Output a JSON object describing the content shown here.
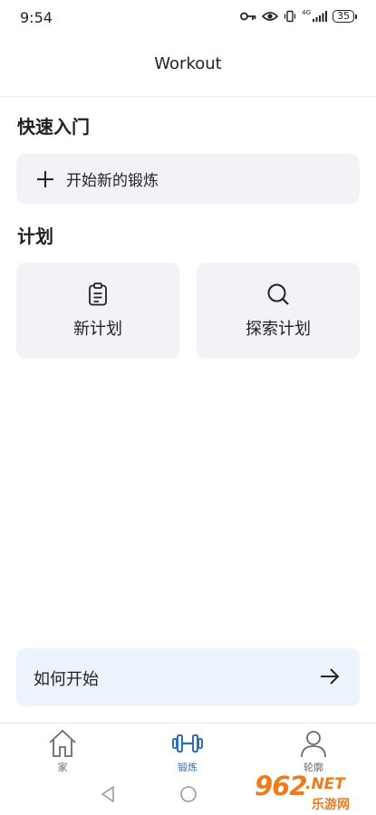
{
  "status_bar": {
    "time": "9:54",
    "network": "4G",
    "battery": "35"
  },
  "header": {
    "title": "Workout"
  },
  "quick_start": {
    "title": "快速入门",
    "start_button_label": "开始新的锻炼",
    "start_icon": "plus-icon"
  },
  "plans": {
    "title": "计划",
    "cards": [
      {
        "label": "新计划",
        "icon": "clipboard-icon"
      },
      {
        "label": "探索计划",
        "icon": "search-icon"
      }
    ]
  },
  "how_to": {
    "label": "如何开始",
    "icon": "arrow-right-icon"
  },
  "bottom_nav": {
    "items": [
      {
        "label": "家",
        "icon": "home-icon",
        "active": false
      },
      {
        "label": "锻炼",
        "icon": "dumbbell-icon",
        "active": true
      },
      {
        "label": "轮廓",
        "icon": "person-icon",
        "active": false
      }
    ]
  },
  "system_nav": {
    "buttons": [
      "back-icon",
      "home-circle-icon"
    ]
  },
  "watermark": {
    "brand": "962",
    "domain": ".NET",
    "subtitle": "乐游网"
  },
  "colors": {
    "accent": "#2f6fb8",
    "card_background": "#f2f3f6",
    "howto_background": "#ebf3fd",
    "watermark": "#f07a1a"
  }
}
